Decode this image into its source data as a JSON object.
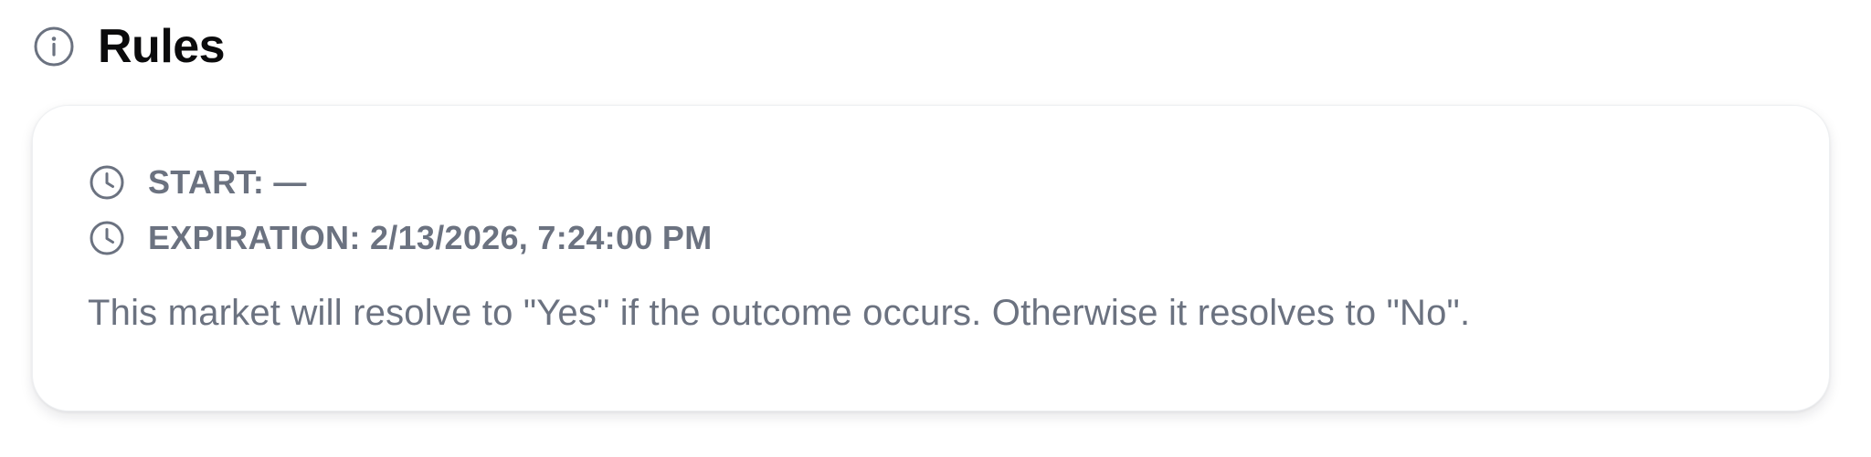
{
  "section": {
    "title": "Rules",
    "icon": "info-icon"
  },
  "card": {
    "start": {
      "icon": "clock-icon",
      "text": "START: —"
    },
    "expiration": {
      "icon": "clock-icon",
      "text": "EXPIRATION: 2/13/2026, 7:24:00 PM"
    },
    "description": "This market will resolve to \"Yes\" if the outcome occurs. Otherwise it resolves to \"No\"."
  },
  "colors": {
    "title": "#0b0b0c",
    "muted_text": "#6b7280",
    "icon_stroke": "#6b7280",
    "card_background": "#ffffff"
  }
}
